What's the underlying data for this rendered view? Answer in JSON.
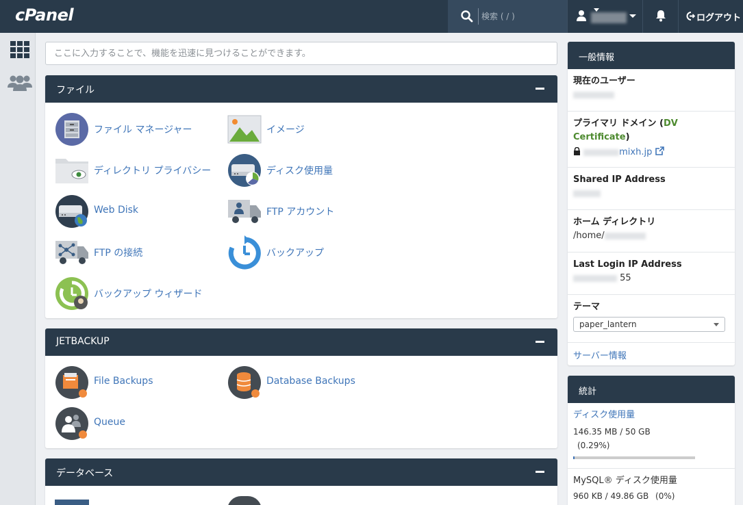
{
  "topbar": {
    "logo": "cPanel",
    "search_placeholder": "検索 ( / )",
    "logout_label": "ログアウト"
  },
  "colors": {
    "header": "#293a4a",
    "link": "#3f75b8",
    "accent_green": "#4d8a2f",
    "background": "#eef0f3"
  },
  "main_search": {
    "placeholder": "ここに入力することで、機能を迅速に見つけることができます。"
  },
  "sections": [
    {
      "title": "ファイル",
      "items": [
        {
          "label": "ファイル マネージャー",
          "icon": "file-manager-icon"
        },
        {
          "label": "イメージ",
          "icon": "image-icon"
        },
        {
          "label": "ディレクトリ プライバシー",
          "icon": "folder-eye-icon"
        },
        {
          "label": "ディスク使用量",
          "icon": "disk-usage-icon"
        },
        {
          "label": "Web Disk",
          "icon": "web-disk-icon"
        },
        {
          "label": "FTP アカウント",
          "icon": "ftp-account-icon"
        },
        {
          "label": "FTP の接続",
          "icon": "ftp-connections-icon"
        },
        {
          "label": "バックアップ",
          "icon": "backup-icon"
        },
        {
          "label": "バックアップ ウィザード",
          "icon": "backup-wizard-icon"
        }
      ]
    },
    {
      "title": "JETBACKUP",
      "items": [
        {
          "label": "File Backups",
          "icon": "file-backups-icon"
        },
        {
          "label": "Database Backups",
          "icon": "database-backups-icon"
        },
        {
          "label": "Queue",
          "icon": "queue-icon"
        }
      ]
    },
    {
      "title": "データベース",
      "items": []
    }
  ],
  "general_info": {
    "title": "一般情報",
    "current_user_label": "現在のユーザー",
    "primary_domain_label": "プライマリ ドメイン",
    "primary_domain_badge": "DV Certificate",
    "primary_domain_value": "mixh.jp",
    "shared_ip_label": "Shared IP Address",
    "home_dir_label": "ホーム ディレクトリ",
    "home_dir_value": "/home/",
    "last_login_label": "Last Login IP Address",
    "last_login_value": "55",
    "theme_label": "テーマ",
    "theme_value": "paper_lantern",
    "server_info_link": "サーバー情報"
  },
  "stats": {
    "title": "統計",
    "disk_label": "ディスク使用量",
    "disk_value": "146.35 MB / 50 GB",
    "disk_percent": "(0.29%)",
    "disk_fraction": 0.0029,
    "mysql_label": "MySQL® ディスク使用量",
    "mysql_value": "960 KB / 49.86 GB",
    "mysql_percent": "(0%)"
  }
}
